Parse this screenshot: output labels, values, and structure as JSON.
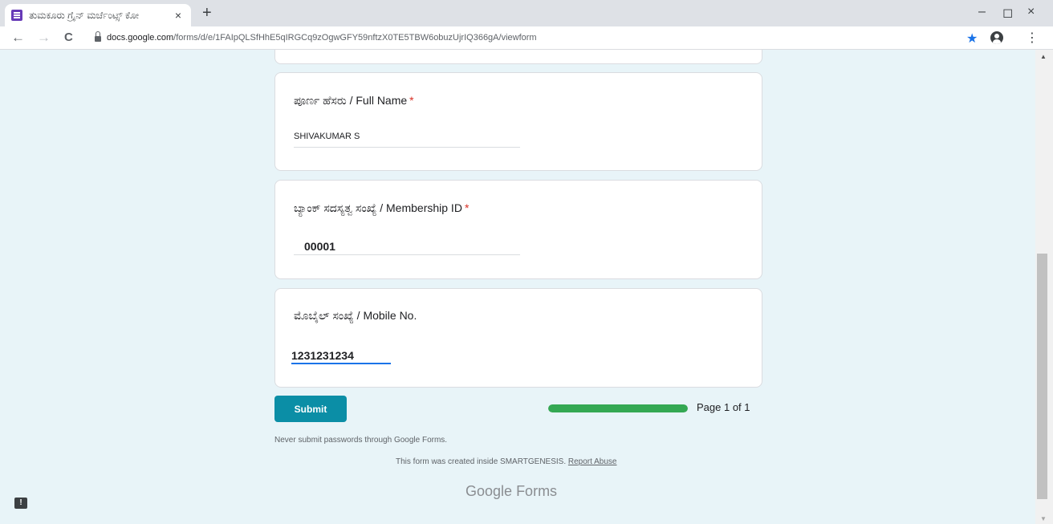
{
  "browser": {
    "tab_title": "ತುಮಕೂರು ಗ್ರೈನ್ ಮರ್ಚೆಂಟ್ಸ್ ಕೋ",
    "tab_close": "×",
    "new_tab": "+",
    "minimize": "–",
    "restore": "◻",
    "close": "×",
    "back": "←",
    "forward": "→",
    "reload": "C",
    "url_host": "docs.google.com",
    "url_path": "/forms/d/e/1FAIpQLSfHhE5qIRGCq9zOgwGFY59nftzX0TE5TBW6obuzUjrIQ366gA/viewform",
    "bookmark_star": "★",
    "menu": "⋮"
  },
  "form": {
    "questions": [
      {
        "title": "ಪೂರ್ಣ ಹೆಸರು / Full Name",
        "required_mark": "*",
        "answer": "SHIVAKUMAR S"
      },
      {
        "title": "ಬ್ಯಾಂಕ್ ಸದಸ್ಯತ್ವ ಸಂಖ್ಯೆ / Membership ID",
        "required_mark": "*",
        "answer": "00001"
      },
      {
        "title": "ಮೊಬೈಲ್ ಸಂಖ್ಯೆ / Mobile No.",
        "answer": "1231231234"
      }
    ],
    "submit_label": "Submit",
    "progress_fraction": 1.0,
    "page_label": "Page 1 of 1",
    "password_warning": "Never submit passwords through Google Forms.",
    "footer_text": "This form was created inside SMARTGENESIS.",
    "report_abuse": "Report Abuse",
    "logo_google": "Google",
    "logo_forms": "Forms"
  },
  "colors": {
    "page_background": "#e8f4f8",
    "submit_button": "#0b8ea6",
    "progress_fill": "#34a853",
    "required": "#d93025"
  }
}
